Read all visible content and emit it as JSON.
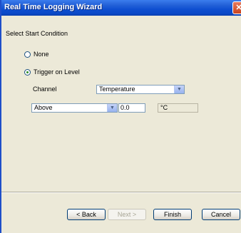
{
  "window": {
    "title": "Real Time Logging Wizard",
    "close_glyph": "✕"
  },
  "step": {
    "title": "Select Start Condition"
  },
  "options": [
    {
      "label": "None",
      "checked": false
    },
    {
      "label": "Trigger on Level",
      "checked": true
    }
  ],
  "channel": {
    "label": "Channel",
    "selected": "Temperature"
  },
  "condition": {
    "selected": "Above",
    "value": "0.0",
    "unit": "°C"
  },
  "buttons": {
    "back": "< Back",
    "next": "Next >",
    "finish": "Finish",
    "cancel": "Cancel"
  },
  "icons": {
    "dropdown_arrow": "chevron-down-icon",
    "close": "close-icon"
  },
  "colors": {
    "titlebar": "#0a49c8",
    "dialog_bg": "#ece9d8",
    "field_border": "#7f9db9"
  }
}
